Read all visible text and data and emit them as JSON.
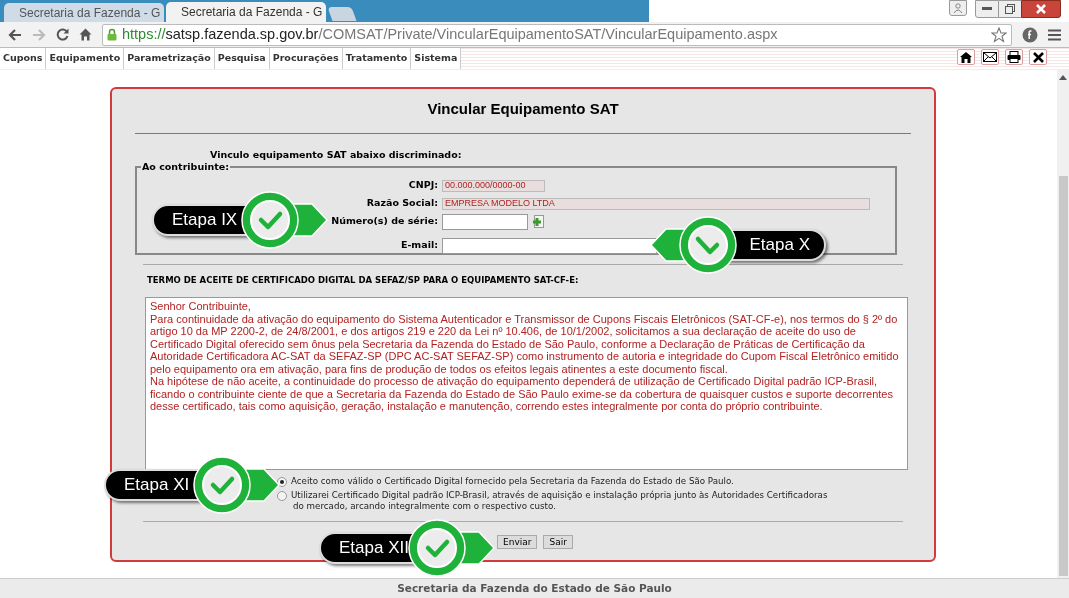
{
  "browser": {
    "tabs": [
      {
        "title": "Secretaria da Fazenda - G",
        "selected": false
      },
      {
        "title": "Secretaria da Fazenda - G",
        "selected": true
      }
    ],
    "url": {
      "scheme": "https://",
      "host": "satsp.fazenda.sp.gov.br",
      "path": "/COMSAT/Private/VincularEquipamentoSAT/VincularEquipamento.aspx"
    }
  },
  "menu": [
    "Cupons",
    "Equipamento",
    "Parametrização",
    "Pesquisa",
    "Procurações",
    "Tratamento",
    "Sistema"
  ],
  "form": {
    "title": "Vincular Equipamento SAT",
    "intro": "Vinculo equipamento SAT abaixo discriminado:",
    "legend": "Ao contribuinte:",
    "fields": [
      {
        "label": "CNPJ:",
        "value": "00.000.000/0000-00",
        "disabled": true,
        "kind": "short"
      },
      {
        "label": "Razão Social:",
        "value": "EMPRESA MODELO LTDA",
        "disabled": true,
        "kind": "wide"
      },
      {
        "label": "Número(s) de série:",
        "disabled": false,
        "kind": "serial"
      },
      {
        "label": "E-mail:",
        "disabled": false,
        "kind": "email"
      }
    ],
    "terms_title": "TERMO DE ACEITE DE CERTIFICADO DIGITAL DA SEFAZ/SP PARA O EQUIPAMENTO SAT-CF-E:",
    "terms": [
      "Senhor Contribuinte,",
      "Para continuidade da ativação do equipamento do Sistema Autenticador e Transmissor de Cupons Fiscais Eletrônicos (SAT-CF-e), nos termos do § 2º do artigo 10 da MP 2200-2, de 24/8/2001, e dos artigos 219 e 220 da Lei nº 10.406, de 10/1/2002, solicitamos a sua declaração de aceite do uso de Certificado Digital oferecido sem ônus pela Secretaria da Fazenda do Estado de São Paulo, conforme a Declaração de Práticas de Certificação da Autoridade Certificadora AC-SAT da SEFAZ-SP (DPC AC-SAT SEFAZ-SP) como instrumento de autoria e integridade do Cupom Fiscal Eletrônico emitido pelo equipamento ora em ativação, para fins de produção de todos os efeitos legais atinentes a este documento fiscal.",
      "Na hipótese de não aceite, a continuidade do processo de ativação do equipamento dependerá de utilização de Certificado Digital padrão ICP-Brasil, ficando o contribuinte ciente de que a Secretaria da Fazenda do Estado de São Paulo exime-se da cobertura de quaisquer custos e suporte decorrentes desse certificado, tais como aquisição, geração, instalação e manutenção, correndo estes integralmente por conta do próprio contribuinte."
    ],
    "options": [
      {
        "label": "Aceito como válido o Certificado Digital fornecido pela Secretaria da Fazenda do Estado de São Paulo.",
        "selected": true
      },
      {
        "label": "Utilizarei Certificado Digital padrão ICP-Brasil, através de aquisição e instalação própria junto às Autoridades Certificadoras do mercado, arcando integralmente com o respectivo custo.",
        "selected": false
      }
    ],
    "buttons": [
      "Enviar",
      "Sair"
    ]
  },
  "footer": "Secretaria da Fazenda do Estado de São Paulo",
  "callouts": [
    {
      "label": "Etapa IX",
      "kind": "right"
    },
    {
      "label": "Etapa X",
      "kind": "left"
    },
    {
      "label": "Etapa XI",
      "kind": "right"
    },
    {
      "label": "Etapa XII",
      "kind": "right"
    }
  ]
}
